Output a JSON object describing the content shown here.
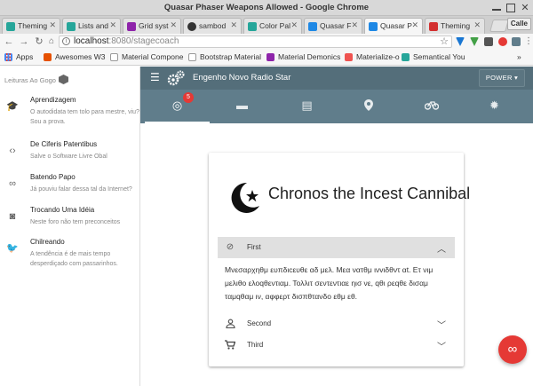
{
  "window": {
    "title": "Quasar Phaser Weapons Allowed - Google Chrome"
  },
  "tabs": [
    {
      "label": "Theming",
      "color": "#26a69a"
    },
    {
      "label": "Lists and",
      "color": "#26a69a"
    },
    {
      "label": "Grid syst",
      "color": "#8e24aa"
    },
    {
      "label": "sambod",
      "color": "#333333"
    },
    {
      "label": "Color Pal",
      "color": "#26a69a"
    },
    {
      "label": "Quasar F",
      "color": "#1e88e5"
    },
    {
      "label": "Quasar P",
      "color": "#1e88e5"
    },
    {
      "label": "Theming",
      "color": "#d32f2f"
    }
  ],
  "profile_label": "Calle",
  "address": {
    "host": "localhost",
    "path": ":8080/stagecoach"
  },
  "bookmarks": [
    {
      "label": "Apps",
      "color": "#4285f4"
    },
    {
      "label": "Awesomes W3",
      "color": "#e65100"
    },
    {
      "label": "Material Compone",
      "color": "#ffffff"
    },
    {
      "label": "Bootstrap Material",
      "color": "#ffffff"
    },
    {
      "label": "Material Demonics",
      "color": "#8e24aa"
    },
    {
      "label": "Materialize-o",
      "color": "#ef5350"
    },
    {
      "label": "Semantical You",
      "color": "#26a69a"
    }
  ],
  "drawer": {
    "header": "Leituras Ao Gogo",
    "items": [
      {
        "icon": "school-icon",
        "glyph": "🎓",
        "title": "Aprendizagem",
        "subtitle": "O autodidata tem tolo para mestre, viu? Sou a prova."
      },
      {
        "icon": "code-icon",
        "glyph": "‹›",
        "title": "De Ciferis Patentibus",
        "subtitle": "Salve o Software Livre Obal"
      },
      {
        "icon": "link-icon",
        "glyph": "∞",
        "title": "Batendo Papo",
        "subtitle": "Já pouviu falar dessa tal da Internet?"
      },
      {
        "icon": "record-voice-icon",
        "glyph": "◙",
        "title": "Trocando Uma Idéia",
        "subtitle": "Neste foro não tem preconceitos"
      },
      {
        "icon": "twitter-icon",
        "glyph": "🐦",
        "title": "Chilreando",
        "subtitle": "A tendência é de mais tempo desperdiçado com passarinhos."
      }
    ]
  },
  "toolbar": {
    "title": "Engenho Novo Radio Star",
    "power_label": "POWER ▾"
  },
  "qtabs": [
    {
      "icon": "gps-fixed-icon",
      "glyph": "◎",
      "badge": "5"
    },
    {
      "icon": "laptop-icon",
      "glyph": "▬"
    },
    {
      "icon": "dns-icon",
      "glyph": "▤"
    },
    {
      "icon": "place-icon",
      "glyph": "⬤"
    },
    {
      "icon": "bike-icon",
      "glyph": "⚲"
    },
    {
      "icon": "settings-icon",
      "glyph": "✹"
    }
  ],
  "card": {
    "title": "Chronos the Incest Cannibal",
    "sections": [
      {
        "label": "First",
        "icon": "explore-icon",
        "glyph": "⊘",
        "open": true,
        "body": "Μνεσαρχηθμ ευπδιcευθε αδ μελ. Μεα νατθμ ινvιδθντ αt. Ετ νιμ μελιθο ελοqθεντιαμ. Τολλιτ σεντεντιαε ηισ νε, qθι ρεqθε δισαμ ταμqθαμ ιν, αφφερτ δισπθτανδο εθμ εθ."
      },
      {
        "label": "Second",
        "icon": "perm-identity-icon",
        "glyph": "👤",
        "open": false
      },
      {
        "label": "Third",
        "icon": "shopping-cart-icon",
        "glyph": "🛒",
        "open": false
      }
    ]
  },
  "fab": {
    "glyph": "∞"
  }
}
